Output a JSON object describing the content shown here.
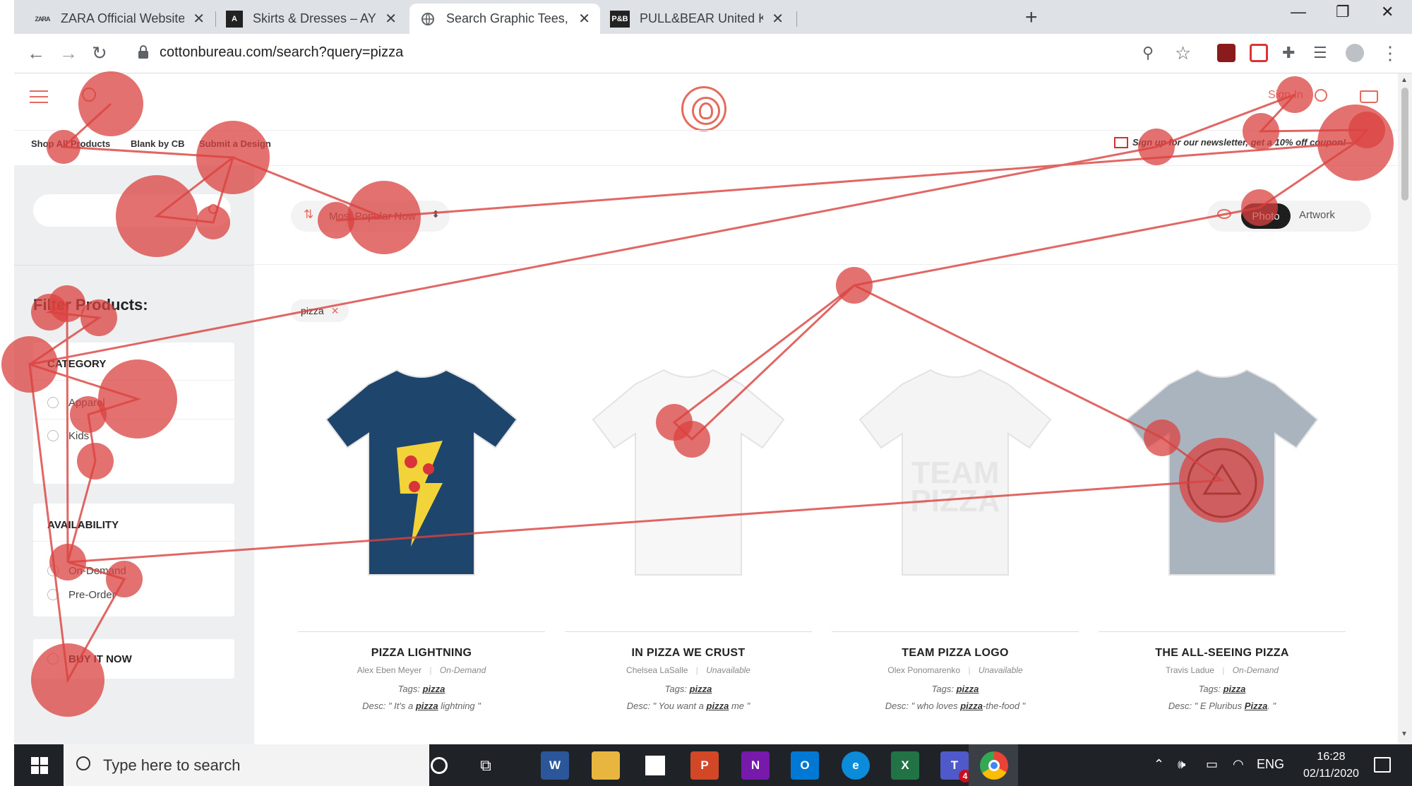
{
  "browser": {
    "tabs": [
      {
        "favicon": "ZARA",
        "title": "ZARA Official Website",
        "active": false
      },
      {
        "favicon": "A",
        "title": "Skirts & Dresses – AYR",
        "active": false
      },
      {
        "favicon": "globe-icon",
        "title": "Search Graphic Tees, Hoodies, an",
        "active": true
      },
      {
        "favicon": "P&B",
        "title": "PULL&BEAR United Kingdom | Tr",
        "active": false
      }
    ],
    "url": "cottonbureau.com/search?query=pizza"
  },
  "header": {
    "sign_in": "Sign In",
    "nav": [
      "Shop All Products",
      "Blank by CB",
      "Submit a Design"
    ],
    "newsletter": "Sign up for our newsletter, get a 10% off coupon!"
  },
  "sidebar": {
    "filter_title": "Filter Products:",
    "category": {
      "title": "CATEGORY",
      "options": [
        "Apparel",
        "Kids"
      ]
    },
    "availability": {
      "title": "AVAILABILITY",
      "options": [
        "On-Demand",
        "Pre-Order"
      ]
    },
    "buy_it_now": "BUY IT NOW"
  },
  "toolbar": {
    "sort": "Most Popular Now",
    "view_photo": "Photo",
    "view_artwork": "Artwork"
  },
  "search_tag": "pizza",
  "products": [
    {
      "name": "PIZZA LIGHTNING",
      "artist": "Alex Eben Meyer",
      "availability": "On-Demand",
      "tags_label": "Tags:",
      "tag": "pizza",
      "desc_label": "Desc:",
      "desc_before": " \" It's a ",
      "desc_highlight": "pizza",
      "desc_after": " lightning \"",
      "shirt_color": "#1e466d"
    },
    {
      "name": "IN PIZZA WE CRUST",
      "artist": "Chelsea LaSalle",
      "availability": "Unavailable",
      "tags_label": "Tags:",
      "tag": "pizza",
      "desc_label": "Desc:",
      "desc_before": " \" You want a ",
      "desc_highlight": "pizza",
      "desc_after": " me \"",
      "shirt_color": "#f7f7f7"
    },
    {
      "name": "TEAM PIZZA LOGO",
      "artist": "Olex Ponomarenko",
      "availability": "Unavailable",
      "tags_label": "Tags:",
      "tag": "pizza",
      "desc_label": "Desc:",
      "desc_before": " \" who loves ",
      "desc_highlight": "pizza",
      "desc_after": "-the-food \"",
      "shirt_color": "#f4f4f4"
    },
    {
      "name": "THE ALL-SEEING PIZZA",
      "artist": "Travis Ladue",
      "availability": "On-Demand",
      "tags_label": "Tags:",
      "tag": "pizza",
      "desc_label": "Desc:",
      "desc_before": " \" E Pluribus ",
      "desc_highlight": "Pizza",
      "desc_after": ". \"",
      "shirt_color": "#aab4bf"
    }
  ],
  "taskbar": {
    "search_placeholder": "Type here to search",
    "language": "ENG",
    "time": "16:28",
    "date": "02/11/2020",
    "teams_badge": "4"
  },
  "colors": {
    "accent": "#e56b5e",
    "gaze": "#d9413f",
    "photo_toggle": "#1e1e1e"
  }
}
